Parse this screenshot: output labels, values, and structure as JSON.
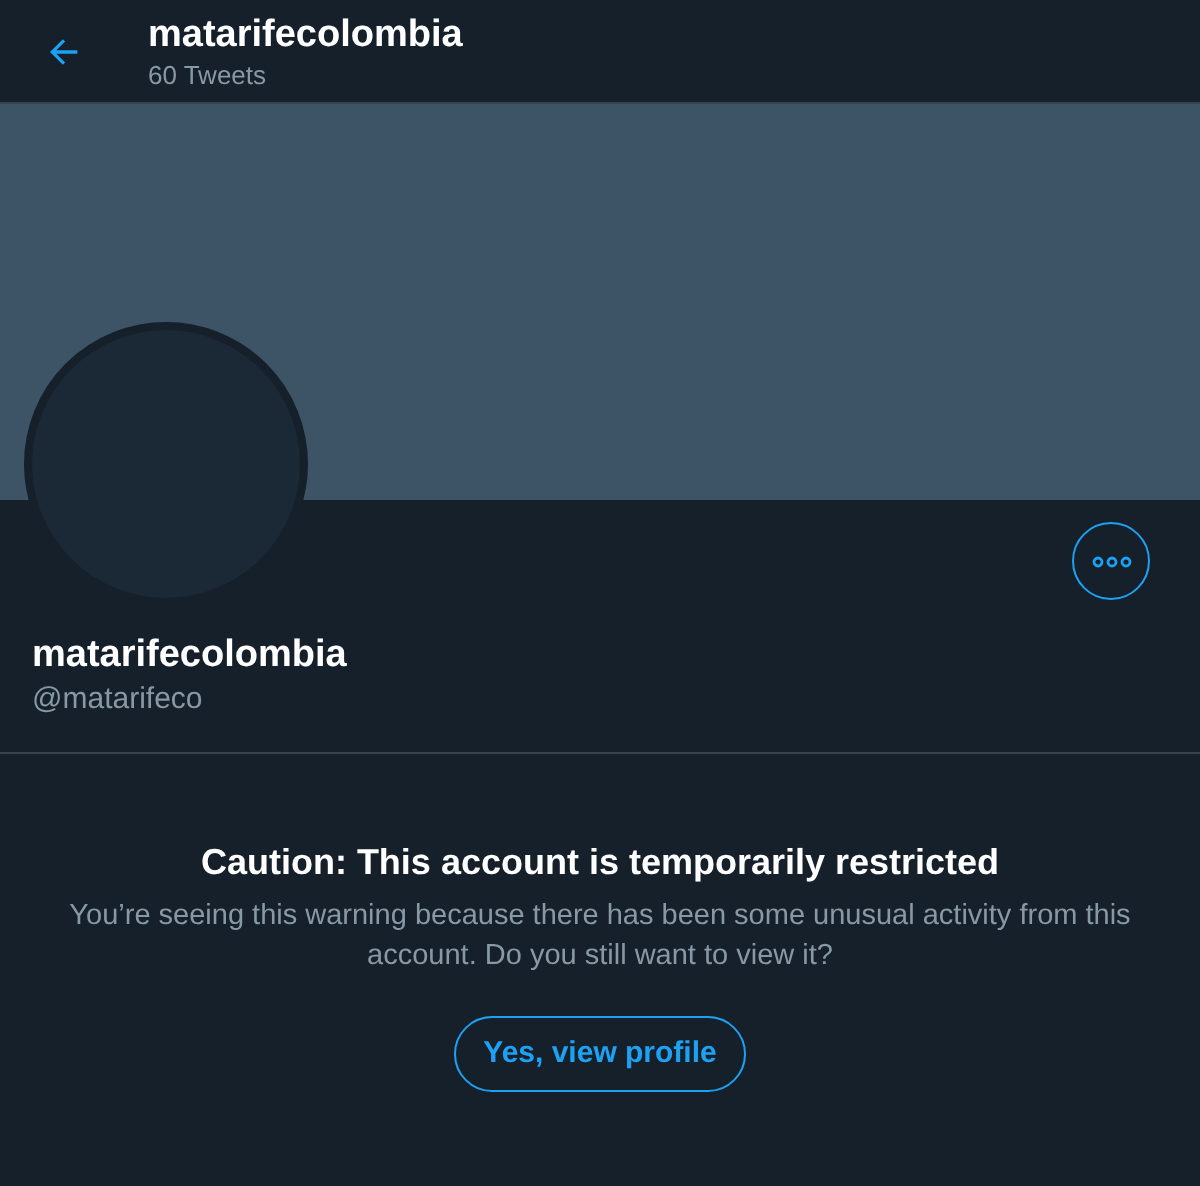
{
  "header": {
    "title": "matarifecolombia",
    "subtitle": "60 Tweets"
  },
  "profile": {
    "name": "matarifecolombia",
    "handle": "@matarifeco"
  },
  "warning": {
    "title": "Caution: This account is temporarily restricted",
    "message": "You’re seeing this warning because there has been some unusual activity from this account. Do you still want to view it?",
    "button": "Yes, view profile"
  }
}
